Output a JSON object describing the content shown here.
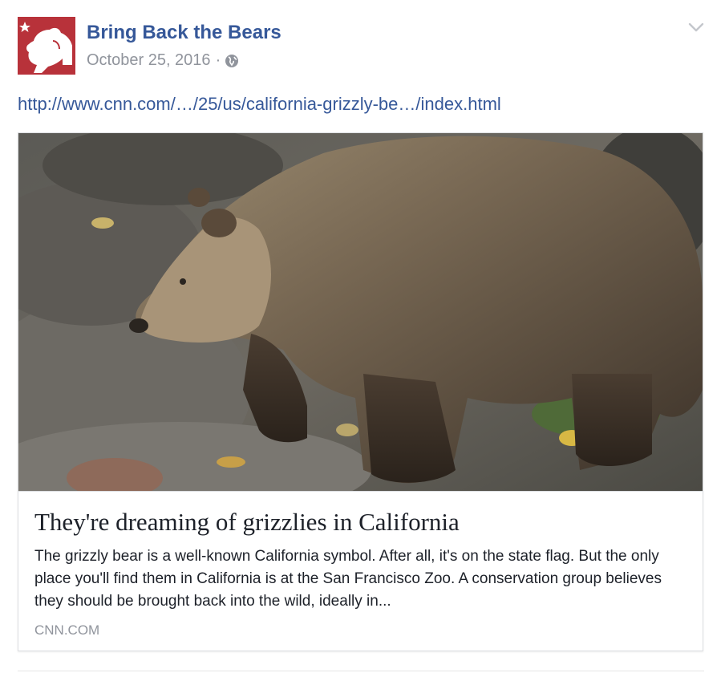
{
  "post": {
    "page_name": "Bring Back the Bears",
    "date": "October 25, 2016",
    "separator": "·",
    "link_text": "http://www.cnn.com/…/25/us/california-grizzly-be…/index.html"
  },
  "icons": {
    "avatar": "bear-logo-icon",
    "privacy": "globe-icon",
    "menu": "chevron-down-icon"
  },
  "card": {
    "title": "They're dreaming of grizzlies in California",
    "description": "The grizzly bear is a well-known California symbol. After all, it's on the state flag. But the only place you'll find them in California is at the San Francisco Zoo. A conservation group believes they should be brought back into the wild, ideally in...",
    "domain": "CNN.COM"
  },
  "colors": {
    "link_blue": "#365899",
    "meta_gray": "#90949c",
    "avatar_red": "#b8323a",
    "text": "#1d2129"
  }
}
